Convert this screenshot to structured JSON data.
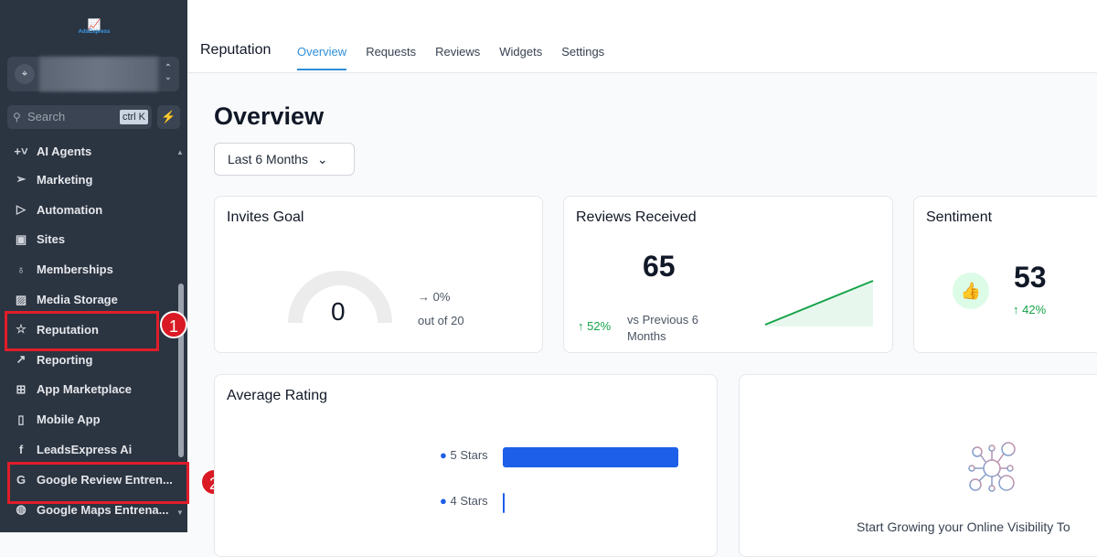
{
  "sidebar": {
    "logo": "AdsExpress",
    "search_placeholder": "Search",
    "search_shortcut": "ctrl K",
    "items": [
      {
        "label": "AI Agents",
        "icon": "sparkle-icon"
      },
      {
        "label": "Marketing",
        "icon": "send-icon"
      },
      {
        "label": "Automation",
        "icon": "play-circle-icon"
      },
      {
        "label": "Sites",
        "icon": "browser-icon"
      },
      {
        "label": "Memberships",
        "icon": "award-icon"
      },
      {
        "label": "Media Storage",
        "icon": "image-icon"
      },
      {
        "label": "Reputation",
        "icon": "star-icon"
      },
      {
        "label": "Reporting",
        "icon": "trend-icon"
      },
      {
        "label": "App Marketplace",
        "icon": "grid-icon"
      },
      {
        "label": "Mobile App",
        "icon": "phone-icon"
      },
      {
        "label": "LeadsExpress Ai",
        "icon": "facebook-icon"
      },
      {
        "label": "Google Review Entren...",
        "icon": "google-icon"
      },
      {
        "label": "Google Maps Entrena...",
        "icon": "globe-icon"
      }
    ]
  },
  "annotations": [
    "1",
    "2"
  ],
  "header": {
    "title": "Reputation",
    "tabs": [
      "Overview",
      "Requests",
      "Reviews",
      "Widgets",
      "Settings"
    ],
    "active_tab": "Overview"
  },
  "main": {
    "title": "Overview",
    "range": "Last 6 Months",
    "invites": {
      "title": "Invites Goal",
      "value": "0",
      "change": "→ 0%",
      "goal": "out of 20",
      "progress": 0
    },
    "reviews": {
      "title": "Reviews Received",
      "value": "65",
      "change": "↑ 52%",
      "compare": "vs Previous 6 Months"
    },
    "sentiment": {
      "title": "Sentiment",
      "value": "53",
      "change": "↑ 42%"
    },
    "rating": {
      "title": "Average Rating",
      "rows": [
        {
          "label": "5 Stars",
          "value": 0.98
        },
        {
          "label": "4 Stars",
          "value": 0.01
        }
      ]
    },
    "empty": {
      "text": "Start Growing your Online Visibility To"
    }
  },
  "colors": {
    "accent": "#2f8fd8",
    "green": "#16a34a",
    "bar": "#1d5fe8",
    "annotation": "#e11d2a"
  }
}
